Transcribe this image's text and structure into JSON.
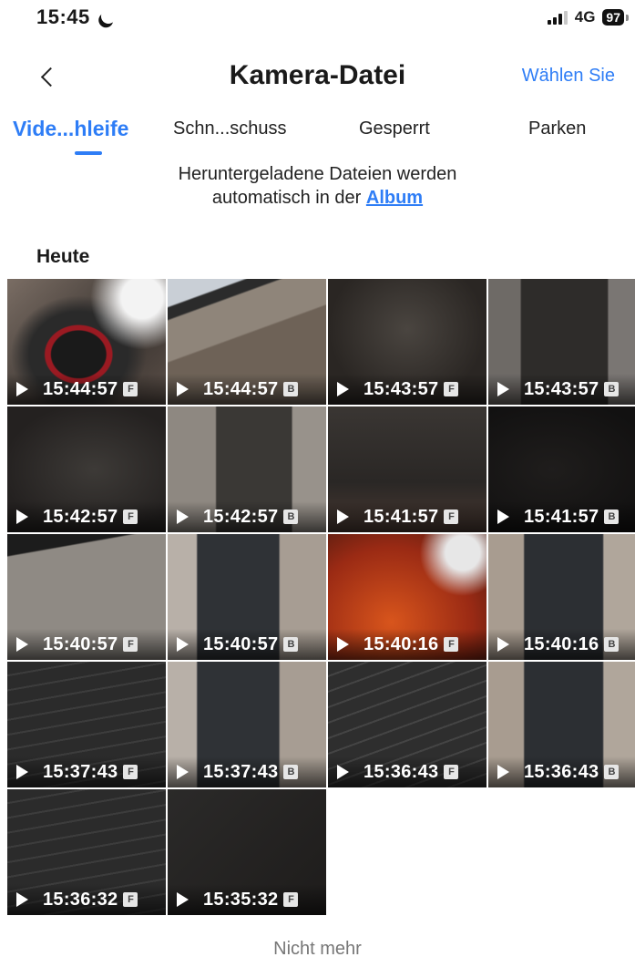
{
  "status": {
    "time": "15:45",
    "network": "4G",
    "battery": "97"
  },
  "header": {
    "title": "Kamera-Datei",
    "select_label": "Wählen Sie"
  },
  "tabs": [
    {
      "label": "Vide...hleife",
      "active": true
    },
    {
      "label": "Schn...schuss",
      "active": false
    },
    {
      "label": "Gesperrt",
      "active": false
    },
    {
      "label": "Parken",
      "active": false
    }
  ],
  "notice": {
    "line1": "Heruntergeladene Dateien werden",
    "line2_prefix": "automatisch in der ",
    "link": "Album"
  },
  "section": {
    "label": "Heute"
  },
  "videos": [
    {
      "time": "15:44:57",
      "badge": "F"
    },
    {
      "time": "15:44:57",
      "badge": "B"
    },
    {
      "time": "15:43:57",
      "badge": "F"
    },
    {
      "time": "15:43:57",
      "badge": "B"
    },
    {
      "time": "15:42:57",
      "badge": "F"
    },
    {
      "time": "15:42:57",
      "badge": "B"
    },
    {
      "time": "15:41:57",
      "badge": "F"
    },
    {
      "time": "15:41:57",
      "badge": "B"
    },
    {
      "time": "15:40:57",
      "badge": "F"
    },
    {
      "time": "15:40:57",
      "badge": "B"
    },
    {
      "time": "15:40:16",
      "badge": "F"
    },
    {
      "time": "15:40:16",
      "badge": "B"
    },
    {
      "time": "15:37:43",
      "badge": "F"
    },
    {
      "time": "15:37:43",
      "badge": "B"
    },
    {
      "time": "15:36:43",
      "badge": "F"
    },
    {
      "time": "15:36:43",
      "badge": "B"
    },
    {
      "time": "15:36:32",
      "badge": "F"
    },
    {
      "time": "15:35:32",
      "badge": "F"
    }
  ],
  "footer": {
    "text": "Nicht mehr"
  }
}
